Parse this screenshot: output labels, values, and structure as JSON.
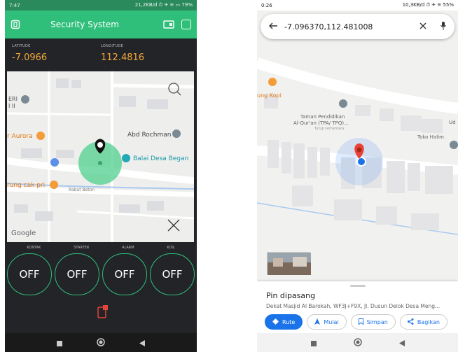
{
  "left_phone": {
    "status": {
      "time": "7:47",
      "right": "21,2KB/d ⏱ ✈ ≋ ▭ 79%"
    },
    "app_title": "Security System",
    "latitude": {
      "label": "LATITUDE",
      "value": "-7.0966"
    },
    "longitude": {
      "label": "LONGITUDE",
      "value": "112.4816"
    },
    "map_labels": {
      "eri": "ERI",
      "eri2": "I II",
      "aurora": "r Aurora",
      "abd": "Abd Rochman",
      "balai": "Balai Desa Began",
      "warung": "rung cak pri",
      "rabat": "Rabat Beton",
      "google": "Google"
    },
    "controls": [
      {
        "label": "KONTAK",
        "state": "OFF"
      },
      {
        "label": "STARTER",
        "state": "OFF"
      },
      {
        "label": "ALARM",
        "state": "OFF"
      },
      {
        "label": "KOIL",
        "state": "OFF"
      }
    ],
    "colors": {
      "accent": "#2fbf7a",
      "value": "#f4a83a"
    }
  },
  "right_phone": {
    "status": {
      "time": "0:26",
      "right": "10,3KB/d ⏱ ✈ ≋ 55%"
    },
    "search_query": "-7.096370,112.481008",
    "map_labels": {
      "kopi": "ung Kopi",
      "taman1": "Taman Pendidikan",
      "taman2": "Al-Qur'an (TPA/ TPQ)...",
      "taman3": "Tutup sementara",
      "toko": "Toko Halim",
      "ud": "Ud"
    },
    "sheet": {
      "title": "Pin dipasang",
      "subtitle": "Dekat Masjid Al Barokah, WF3J+F9X, Jl. Dusun Delok Desa Meng...",
      "buttons": {
        "route": "Rute",
        "start": "Mulai",
        "save": "Simpan",
        "share": "Bagikan"
      }
    }
  }
}
